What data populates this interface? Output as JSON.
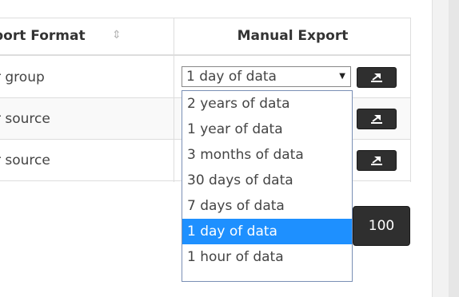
{
  "table": {
    "header": {
      "format_label": "port Format",
      "sort_icon": "⇕",
      "manual_label": "Manual Export"
    },
    "rows": [
      {
        "format": "r group"
      },
      {
        "format": "r source"
      },
      {
        "format": "r source"
      }
    ]
  },
  "export_select": {
    "value": "1 day of data",
    "arrow": "▼",
    "options": [
      "2 years of data",
      "1 year of data",
      "3 months of data",
      "30 days of data",
      "7 days of data",
      "1 day of data",
      "1 hour of data"
    ],
    "selected_index": 5
  },
  "pagination": {
    "page_size_label": "100"
  },
  "colors": {
    "selected_option_bg": "#1e90ff",
    "button_bg": "#2f2f2f",
    "border": "#dddddd"
  }
}
